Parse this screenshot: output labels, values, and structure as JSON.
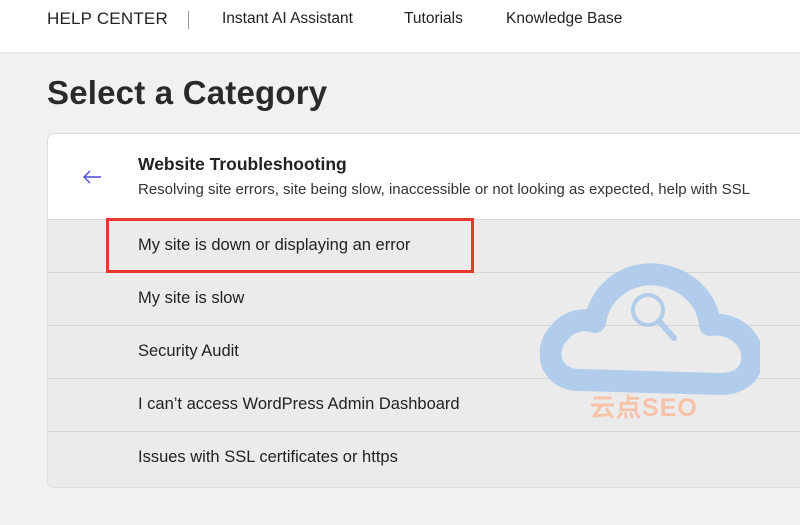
{
  "nav": {
    "brand": "HELP CENTER",
    "links": [
      "Instant AI Assistant",
      "Tutorials",
      "Knowledge Base"
    ]
  },
  "page_title": "Select a Category",
  "category": {
    "title": "Website Troubleshooting",
    "description": "Resolving site errors, site being slow, inaccessible or not looking as expected, help with SSL"
  },
  "options": [
    "My site is down or displaying an error",
    "My site is slow",
    "Security Audit",
    "I can’t access WordPress Admin Dashboard",
    "Issues with SSL certificates or https"
  ],
  "watermark": {
    "text": "云点SEO",
    "cloud_color": "#a9c8ec",
    "text_color": "#f7c2a8"
  },
  "colors": {
    "accent": "#4a4ad8",
    "highlight_box": "#e5392b"
  }
}
